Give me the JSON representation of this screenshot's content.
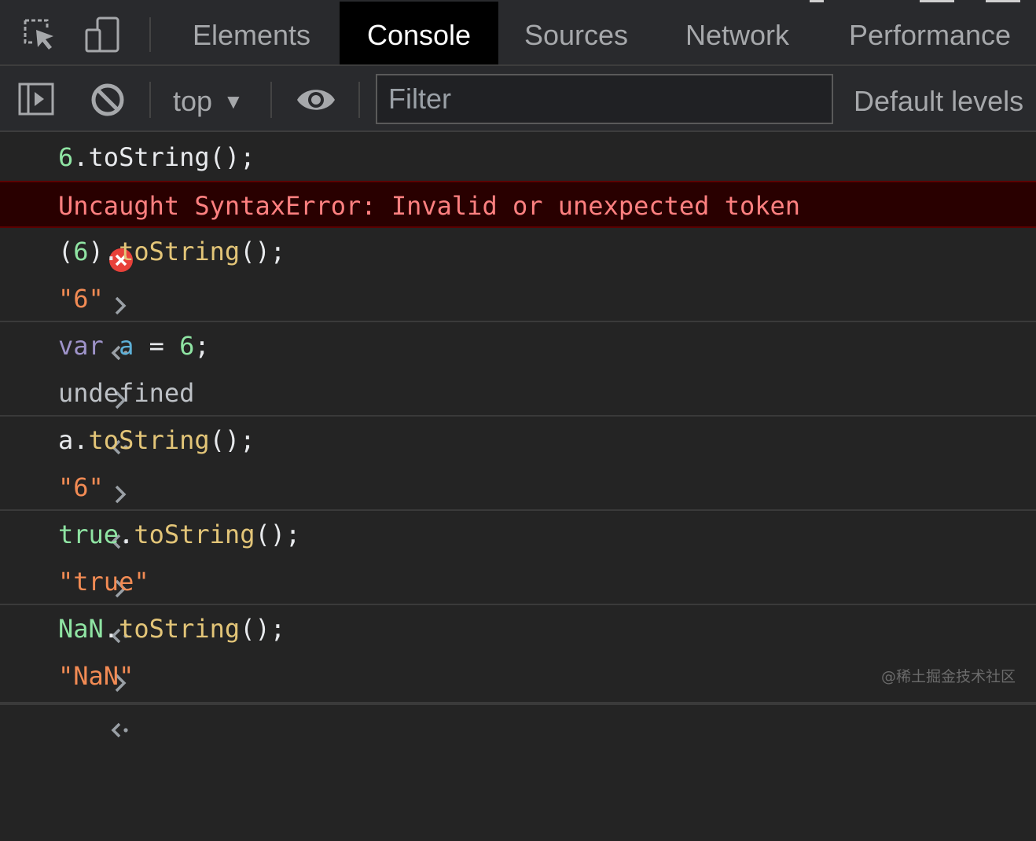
{
  "tabs": [
    {
      "label": "Elements",
      "active": false
    },
    {
      "label": "Console",
      "active": true
    },
    {
      "label": "Sources",
      "active": false
    },
    {
      "label": "Network",
      "active": false
    },
    {
      "label": "Performance",
      "active": false
    }
  ],
  "toolbar": {
    "context": "top",
    "filter_placeholder": "Filter",
    "levels": "Default levels"
  },
  "console": {
    "l1": {
      "num": "6",
      "rest": ".toString();"
    },
    "l2": {
      "error": "Uncaught SyntaxError: Invalid or unexpected token"
    },
    "l3": {
      "open": "(",
      "num": "6",
      "close": ").",
      "method": "toString",
      "end": "();"
    },
    "l4": {
      "value": "\"6\""
    },
    "l5": {
      "kw": "var",
      "var": "a",
      "eq": " = ",
      "num": "6",
      "end": ";"
    },
    "l6": {
      "value": "undefined"
    },
    "l7": {
      "obj": "a.",
      "method": "toString",
      "end": "();"
    },
    "l8": {
      "value": "\"6\""
    },
    "l9": {
      "obj": "true",
      "dot": ".",
      "method": "toString",
      "end": "();"
    },
    "l10": {
      "value": "\"true\""
    },
    "l11": {
      "obj": "NaN",
      "dot": ".",
      "method": "toString",
      "end": "();"
    },
    "l12": {
      "value": "\"NaN\""
    }
  },
  "watermark": "@稀土掘金技术社区",
  "colors": {
    "error_bg": "#290000",
    "error_text": "#ff8080",
    "string": "#f28b54",
    "method": "#e3c578",
    "number": "#8fe4a3",
    "keyword": "#9e93c9",
    "variable": "#5db0d7"
  }
}
